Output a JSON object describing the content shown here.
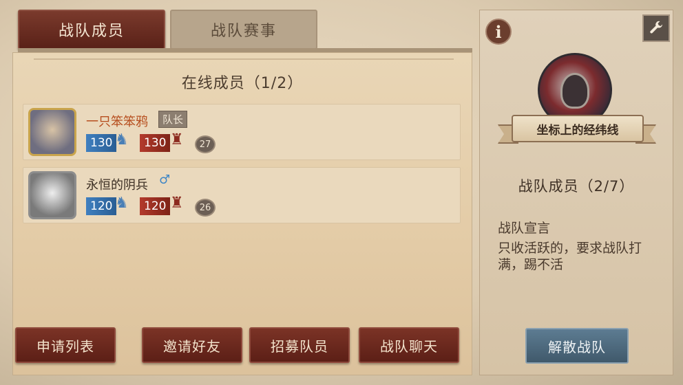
{
  "tabs": {
    "members": "战队成员",
    "matches": "战队赛事"
  },
  "online": {
    "title": "在线成员（1/2）"
  },
  "members": [
    {
      "name": "一只笨笨鸦",
      "badge": "队长",
      "survivor_rank": "130",
      "hunter_rank": "130",
      "level": "27"
    },
    {
      "name": "永恒的阴兵",
      "gender_icon": "♂",
      "survivor_rank": "120",
      "hunter_rank": "120",
      "level": "26"
    }
  ],
  "buttons": {
    "apply_list": "申请列表",
    "invite_friends": "邀请好友",
    "recruit": "招募队员",
    "team_chat": "战队聊天",
    "disband": "解散战队"
  },
  "team": {
    "name": "坐标上的经纬线",
    "members_count": "战队成员（2/7）",
    "manifesto_title": "战队宣言",
    "manifesto_text": "只收活跃的，要求战队打满，踢不活"
  },
  "icons": {
    "info": "info-icon",
    "settings": "wrench-icon"
  }
}
